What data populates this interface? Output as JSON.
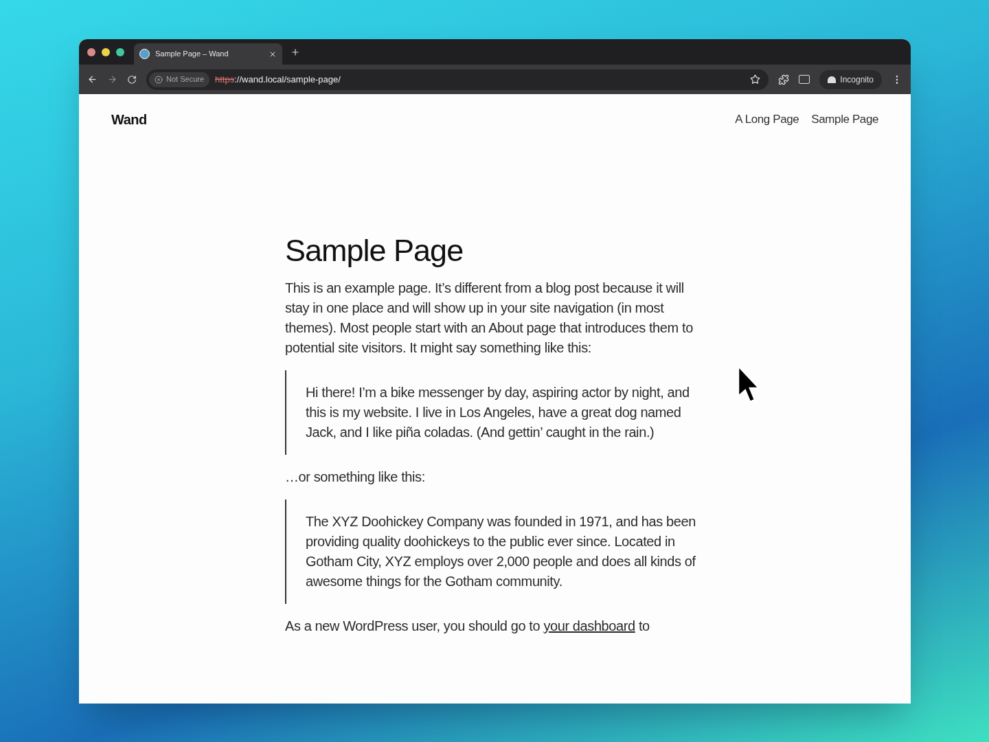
{
  "browser": {
    "tab": {
      "title": "Sample Page – Wand",
      "selected": true
    },
    "security": "Not Secure",
    "url_scheme": "https",
    "url_rest": "://wand.local/sample-page/",
    "profile": "Incognito"
  },
  "site": {
    "title": "Wand",
    "nav": [
      "A Long Page",
      "Sample Page"
    ]
  },
  "page": {
    "title": "Sample Page",
    "blocks": [
      {
        "kind": "paragraph",
        "text": "This is an example page. It’s different from a blog post because it will stay in one place and will show up in your site navigation (in most themes). Most people start with an About page that introduces them to potential site visitors. It might say something like this:"
      },
      {
        "kind": "quote",
        "text": "Hi there! I’m a bike messenger by day, aspiring actor by night, and this is my website. I live in Los Angeles, have a great dog named Jack, and I like piña coladas. (And gettin’ caught in the rain.)"
      },
      {
        "kind": "paragraph",
        "text": "…or something like this:"
      },
      {
        "kind": "quote",
        "text": "The XYZ Doohickey Company was founded in 1971, and has been providing quality doohickeys to the public ever since. Located in Gotham City, XYZ employs over 2,000 people and does all kinds of awesome things for the Gotham community."
      },
      {
        "kind": "link_paragraph",
        "before": "As a new WordPress user, you should go to ",
        "link": "your dashboard",
        "after": " to"
      }
    ]
  }
}
